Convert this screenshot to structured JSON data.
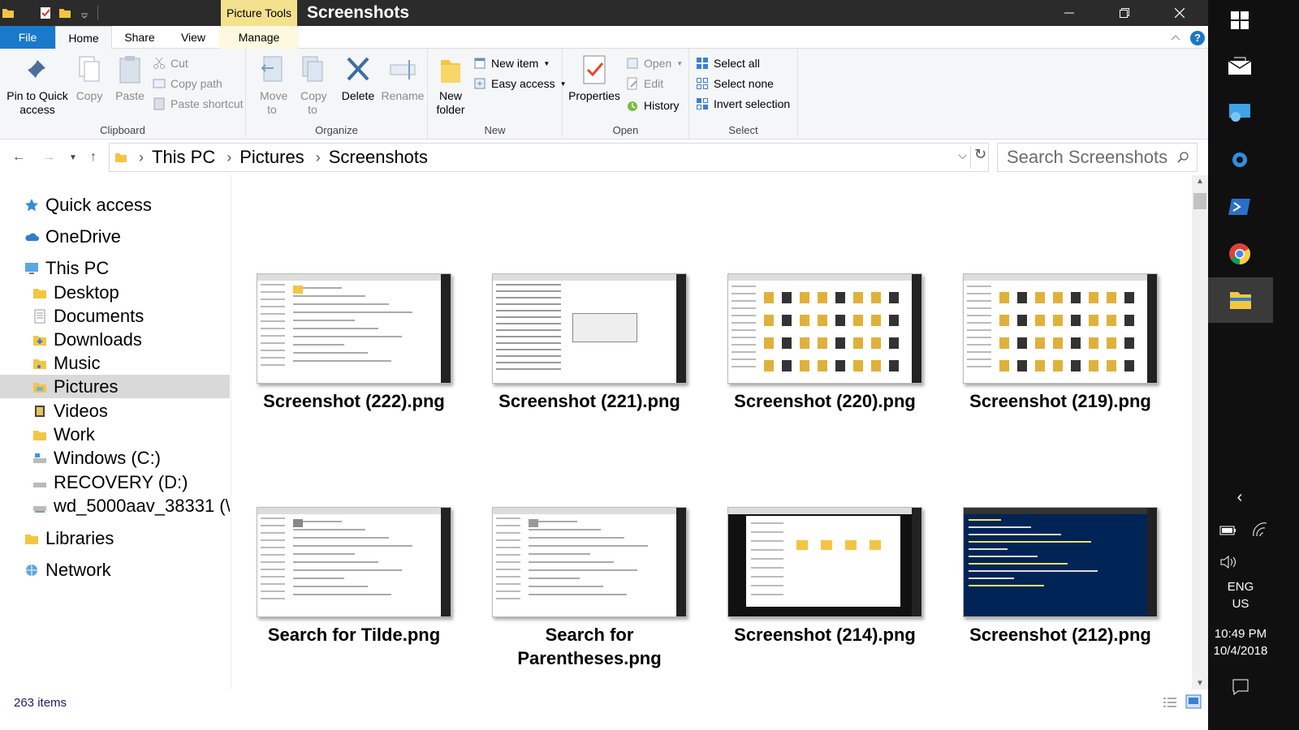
{
  "window": {
    "title": "Screenshots",
    "context_tab": "Picture Tools"
  },
  "ribbon_tabs": [
    "File",
    "Home",
    "Share",
    "View",
    "Manage"
  ],
  "ribbon": {
    "clipboard": {
      "label": "Clipboard",
      "pin": "Pin to Quick access",
      "copy": "Copy",
      "paste": "Paste",
      "cut": "Cut",
      "copy_path": "Copy path",
      "paste_shortcut": "Paste shortcut"
    },
    "organize": {
      "label": "Organize",
      "move_to": "Move to",
      "copy_to": "Copy to",
      "delete": "Delete",
      "rename": "Rename"
    },
    "new": {
      "label": "New",
      "new_folder": "New folder",
      "new_item": "New item",
      "easy_access": "Easy access"
    },
    "open": {
      "label": "Open",
      "properties": "Properties",
      "open": "Open",
      "edit": "Edit",
      "history": "History"
    },
    "select": {
      "label": "Select",
      "select_all": "Select all",
      "select_none": "Select none",
      "invert_selection": "Invert selection"
    }
  },
  "address": {
    "crumbs": [
      "This PC",
      "Pictures",
      "Screenshots"
    ],
    "search_placeholder": "Search Screenshots"
  },
  "nav": {
    "items": [
      {
        "label": "Quick access",
        "icon": "star-icon"
      },
      {
        "label": "OneDrive",
        "icon": "cloud-icon"
      },
      {
        "label": "This PC",
        "icon": "computer-icon"
      },
      {
        "label": "Desktop",
        "icon": "folder-icon"
      },
      {
        "label": "Documents",
        "icon": "documents-icon"
      },
      {
        "label": "Downloads",
        "icon": "download-icon"
      },
      {
        "label": "Music",
        "icon": "music-icon"
      },
      {
        "label": "Pictures",
        "icon": "pictures-icon"
      },
      {
        "label": "Videos",
        "icon": "videos-icon"
      },
      {
        "label": "Work",
        "icon": "folder-icon"
      },
      {
        "label": "Windows (C:)",
        "icon": "drive-icon"
      },
      {
        "label": "RECOVERY (D:)",
        "icon": "drive-icon"
      },
      {
        "label": "wd_5000aav_38331 (\\",
        "icon": "drive-icon"
      },
      {
        "label": "Libraries",
        "icon": "library-icon"
      },
      {
        "label": "Network",
        "icon": "network-icon"
      }
    ]
  },
  "files": [
    {
      "name": "Screenshot (222).png",
      "thumb": "explorer"
    },
    {
      "name": "Screenshot (221).png",
      "thumb": "regedit"
    },
    {
      "name": "Screenshot (220).png",
      "thumb": "explorer-folders"
    },
    {
      "name": "Screenshot (219).png",
      "thumb": "explorer-folders"
    },
    {
      "name": "Search for Tilde.png",
      "thumb": "search"
    },
    {
      "name": "Search for Parentheses.png",
      "thumb": "search-list"
    },
    {
      "name": "Screenshot (214).png",
      "thumb": "dark-explorer"
    },
    {
      "name": "Screenshot (212).png",
      "thumb": "powershell"
    }
  ],
  "status": {
    "item_count": "263 items"
  },
  "taskbar": {
    "language": "ENG",
    "region": "US",
    "time": "10:49 PM",
    "date": "10/4/2018"
  },
  "colors": {
    "file_tab": "#1979ca",
    "picture_tools": "#f3e18e",
    "titlebar": "#2b2b2b",
    "taskbar": "#101010",
    "selection": "#d9d9d9"
  }
}
